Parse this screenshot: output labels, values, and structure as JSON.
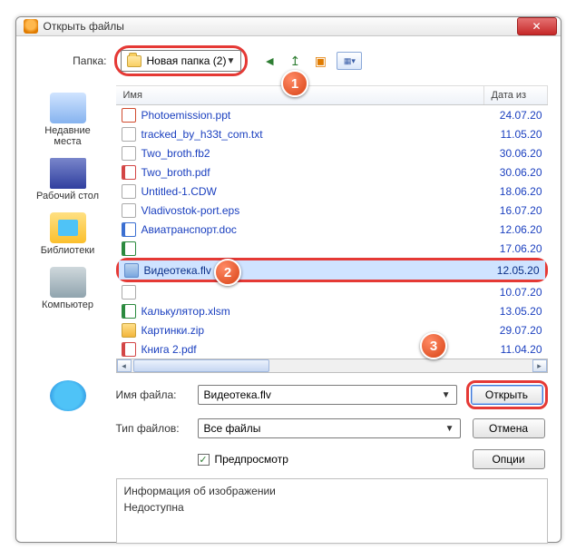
{
  "window": {
    "title": "Открыть файлы"
  },
  "folder": {
    "label": "Папка:",
    "current": "Новая папка (2)"
  },
  "callouts": {
    "one": "1",
    "two": "2",
    "three": "3"
  },
  "places": {
    "recent": "Недавние места",
    "desktop": "Рабочий стол",
    "libraries": "Библиотеки",
    "computer": "Компьютер",
    "network": ""
  },
  "columns": {
    "name": "Имя",
    "date": "Дата из"
  },
  "files": [
    {
      "icon": "fi-ppt",
      "name": "Photoemission.ppt",
      "date": "24.07.20",
      "sel": false
    },
    {
      "icon": "fi-txt",
      "name": "tracked_by_h33t_com.txt",
      "date": "11.05.20",
      "sel": false
    },
    {
      "icon": "fi-fb2",
      "name": "Two_broth.fb2",
      "date": "30.06.20",
      "sel": false
    },
    {
      "icon": "fi-pdf",
      "name": "Two_broth.pdf",
      "date": "30.06.20",
      "sel": false
    },
    {
      "icon": "fi-cdw",
      "name": "Untitled-1.CDW",
      "date": "18.06.20",
      "sel": false
    },
    {
      "icon": "fi-eps",
      "name": "Vladivostok-port.eps",
      "date": "16.07.20",
      "sel": false
    },
    {
      "icon": "fi-doc",
      "name": "Авиатранспорт.doc",
      "date": "12.06.20",
      "sel": false
    },
    {
      "icon": "fi-xls",
      "name": "",
      "date": "17.06.20",
      "sel": false
    },
    {
      "icon": "fi-flv",
      "name": "Видеотека.flv",
      "date": "12.05.20",
      "sel": true
    },
    {
      "icon": "fi-txt",
      "name": "",
      "date": "10.07.20",
      "sel": false
    },
    {
      "icon": "fi-xls",
      "name": "Калькулятор.xlsm",
      "date": "13.05.20",
      "sel": false
    },
    {
      "icon": "fi-zip",
      "name": "Картинки.zip",
      "date": "29.07.20",
      "sel": false
    },
    {
      "icon": "fi-pdf",
      "name": "Книга 2.pdf",
      "date": "11.04.20",
      "sel": false
    }
  ],
  "form": {
    "filename_label": "Имя файла:",
    "filename_value": "Видеотека.flv",
    "filetype_label": "Тип файлов:",
    "filetype_value": "Все файлы"
  },
  "buttons": {
    "open": "Открыть",
    "cancel": "Отмена",
    "options": "Опции"
  },
  "preview": {
    "checkbox_label": "Предпросмотр",
    "checked": "✓"
  },
  "info": {
    "title": "Информация об изображении",
    "value": "Недоступна"
  }
}
